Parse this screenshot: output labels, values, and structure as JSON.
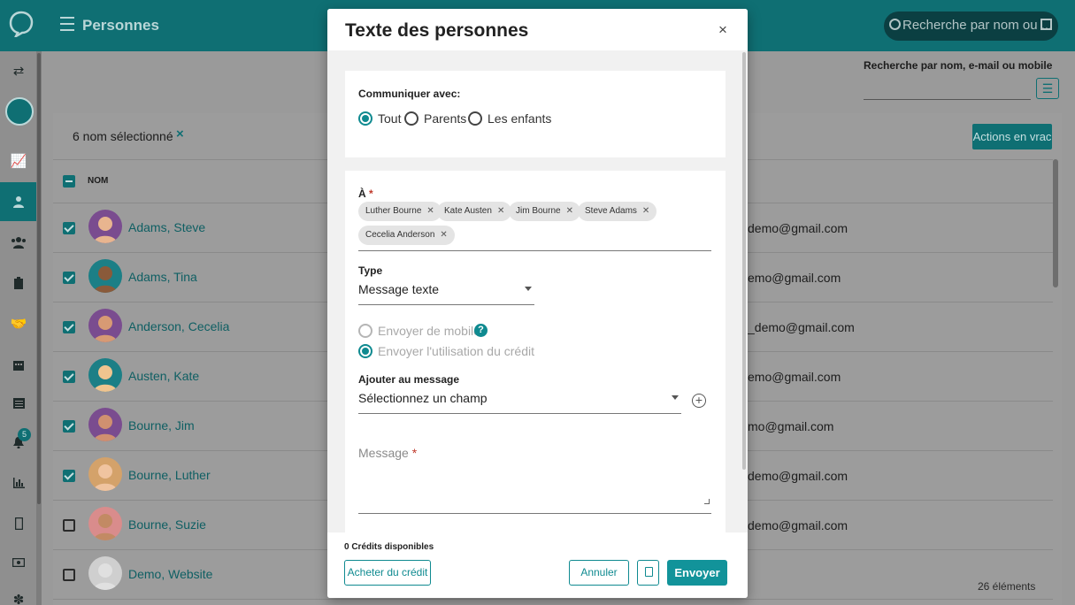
{
  "app": {
    "title": "Personnes",
    "search_placeholder": "Recherche par nom ou ...",
    "notification_count": "5"
  },
  "filter": {
    "label": "Recherche par nom, e-mail ou mobile"
  },
  "selection": {
    "text": "6 nom sélectionné",
    "clear": "×",
    "bulk_action": "Actions en vrac"
  },
  "table": {
    "column_name": "NOM",
    "rows": [
      {
        "name": "Adams, Steve",
        "email": "demo@gmail.com",
        "selected": true
      },
      {
        "name": "Adams, Tina",
        "email": "emo@gmail.com",
        "selected": true
      },
      {
        "name": "Anderson, Cecelia",
        "email": "_demo@gmail.com",
        "selected": true
      },
      {
        "name": "Austen, Kate",
        "email": "emo@gmail.com",
        "selected": true
      },
      {
        "name": "Bourne, Jim",
        "email": "mo@gmail.com",
        "selected": true
      },
      {
        "name": "Bourne, Luther",
        "email": "demo@gmail.com",
        "selected": true
      },
      {
        "name": "Bourne, Suzie",
        "email": "demo@gmail.com",
        "selected": false
      },
      {
        "name": "Demo, Website",
        "email": "",
        "selected": false
      }
    ],
    "footer_count": "26 éléments"
  },
  "modal": {
    "title": "Texte des personnes",
    "close": "×",
    "communicate": {
      "label": "Communiquer avec:",
      "options": [
        "Tout",
        "Parents",
        "Les enfants"
      ],
      "selected": "Tout"
    },
    "to": {
      "label": "À",
      "required_mark": "*",
      "recipients": [
        "Luther Bourne",
        "Kate Austen",
        "Jim Bourne",
        "Steve Adams",
        "Cecelia Anderson"
      ]
    },
    "type": {
      "label": "Type",
      "value": "Message texte"
    },
    "send_options": {
      "from_mobile": "Envoyer de mobile",
      "use_credit": "Envoyer l'utilisation du crédit",
      "help": "?"
    },
    "add_to_message": {
      "label": "Ajouter au message",
      "value": "Sélectionnez un champ"
    },
    "message": {
      "label": "Message",
      "required_mark": "*"
    },
    "footer": {
      "credits": "0 Crédits disponibles",
      "buy_credit": "Acheter du crédit",
      "cancel": "Annuler",
      "send": "Envoyer"
    }
  },
  "colors": {
    "brand": "#0f6f73",
    "accent": "#12939a",
    "link": "#0f5f63"
  }
}
